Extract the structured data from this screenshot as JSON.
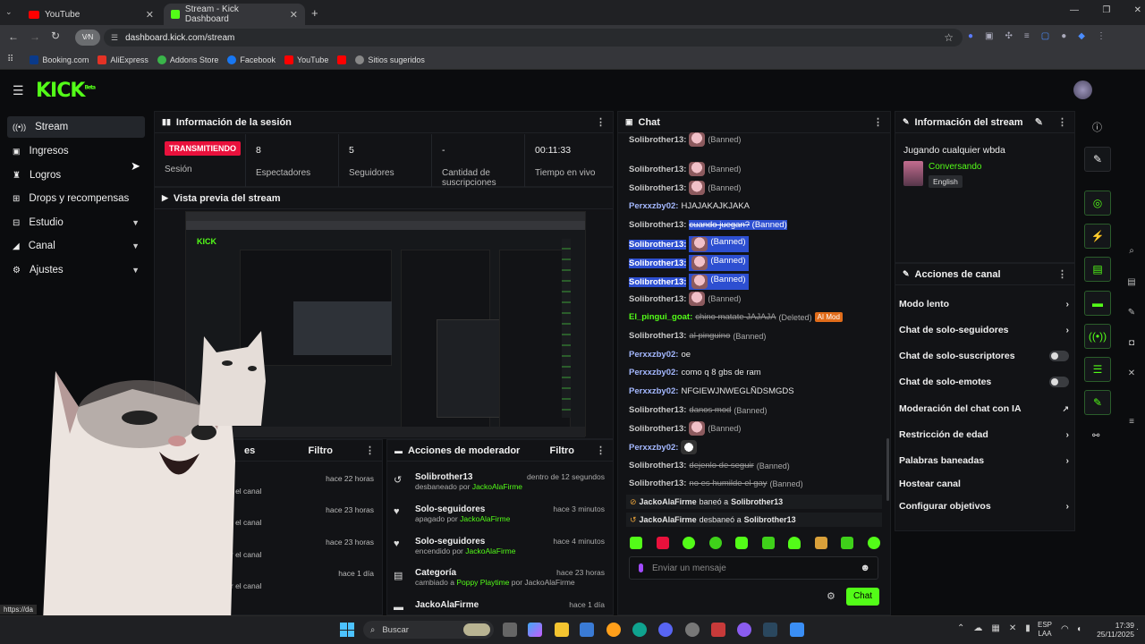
{
  "browser": {
    "tabs": [
      {
        "label": "YouTube"
      },
      {
        "label": "Stream - Kick Dashboard"
      }
    ],
    "url": "dashboard.kick.com/stream",
    "bookmarks": [
      "Booking.com",
      "AliExpress",
      "Addons Store",
      "Facebook",
      "YouTube",
      "Sitios sugeridos"
    ]
  },
  "logo": "KICK",
  "logo_sup": "Beta",
  "sidebar": {
    "items": [
      {
        "label": "Stream"
      },
      {
        "label": "Ingresos"
      },
      {
        "label": "Logros"
      },
      {
        "label": "Drops y recompensas"
      },
      {
        "label": "Estudio"
      },
      {
        "label": "Canal"
      },
      {
        "label": "Ajustes"
      }
    ]
  },
  "session": {
    "title": "Información de la sesión",
    "live_badge": "TRANSMITIENDO",
    "live_label": "Sesión",
    "stats": [
      {
        "value": "8",
        "label": "Espectadores"
      },
      {
        "value": "5",
        "label": "Seguidores"
      },
      {
        "value": "-",
        "label": "Cantidad de suscripciones"
      },
      {
        "value": "00:11:33",
        "label": "Tiempo en vivo"
      }
    ]
  },
  "preview": {
    "title": "Vista previa del stream"
  },
  "events": {
    "title_suffix": "es",
    "filter": "Filtro",
    "rows": [
      {
        "time": "hace 22 horas",
        "text": "ir el canal"
      },
      {
        "time": "hace 23 horas",
        "text": "ir el canal"
      },
      {
        "time": "hace 23 horas",
        "text": "ir el canal"
      },
      {
        "time": "hace 1 día",
        "text": "ir el canal"
      }
    ]
  },
  "modactions": {
    "title": "Acciones de moderador",
    "filter": "Filtro",
    "rows": [
      {
        "title": "Solibrother13",
        "pre": "desbaneado por",
        "by": "JackoAlaFirme",
        "post": "",
        "time": "dentro de 12 segundos"
      },
      {
        "title": "Solo-seguidores",
        "pre": "apagado por",
        "by": "JackoAlaFirme",
        "post": "",
        "time": "hace 3 minutos"
      },
      {
        "title": "Solo-seguidores",
        "pre": "encendido por",
        "by": "JackoAlaFirme",
        "post": "",
        "time": "hace 4 minutos"
      },
      {
        "title": "Categoría",
        "pre": "cambiado a",
        "by": "Poppy Playtime",
        "post": "por JackoAlaFirme",
        "time": "hace 23 horas"
      },
      {
        "title": "JackoAlaFirme",
        "pre": "",
        "by": "",
        "post": "",
        "time": "hace 1 día"
      }
    ]
  },
  "chat": {
    "title": "Chat",
    "lines": [
      {
        "user": "Solibrother13:",
        "msg": "",
        "ban": "(Banned)",
        "emote": true
      },
      {
        "user": "Solibrother13:",
        "msg": "",
        "ban": "(Banned)",
        "emote": true
      },
      {
        "user": "Solibrother13:",
        "msg": "",
        "ban": "(Banned)",
        "emote": true
      },
      {
        "user": "Perxxzby02:",
        "msg": "HJAJAKAJKJAKA",
        "ban": ""
      },
      {
        "user": "Solibrother13:",
        "msg": "cuando juegan?",
        "ban": "(Banned)"
      },
      {
        "user": "Solibrother13:",
        "msg": "",
        "ban": "(Banned)",
        "emote": true
      },
      {
        "user": "Solibrother13:",
        "msg": "",
        "ban": "(Banned)",
        "emote": true
      },
      {
        "user": "Solibrother13:",
        "msg": "",
        "ban": "(Banned)",
        "emote": true
      },
      {
        "user": "Solibrother13:",
        "msg": "",
        "ban": "(Banned)",
        "emote": true
      },
      {
        "user": "El_pingui_goat:",
        "msg": "chino matate JAJAJA",
        "ban": "(Deleted)",
        "tag": "AI Mod"
      },
      {
        "user": "Solibrother13:",
        "msg": "al pinguino",
        "ban": "(Banned)"
      },
      {
        "user": "Perxxzby02:",
        "msg": "oe",
        "ban": ""
      },
      {
        "user": "Perxxzby02:",
        "msg": "como q 8 gbs de ram",
        "ban": ""
      },
      {
        "user": "Perxxzby02:",
        "msg": "NFGIEWJNWEGLÑDSMGDS",
        "ban": ""
      },
      {
        "user": "Solibrother13:",
        "msg": "danos mod",
        "ban": "(Banned)"
      },
      {
        "user": "Solibrother13:",
        "msg": "",
        "ban": "(Banned)",
        "emote": true
      },
      {
        "user": "Perxxzby02:",
        "msg": "",
        "ban": "",
        "emote": true
      },
      {
        "user": "Solibrother13:",
        "msg": "dejenlo de seguir",
        "ban": "(Banned)"
      },
      {
        "user": "Solibrother13:",
        "msg": "no es humilde el gay",
        "ban": "(Banned)"
      }
    ],
    "system": [
      {
        "actor": "JackoAlaFirme",
        "verb": "baneó a",
        "target": "Solibrother13"
      },
      {
        "actor": "JackoAlaFirme",
        "verb": "desbaneó a",
        "target": "Solibrother13"
      }
    ],
    "input_placeholder": "Enviar un mensaje",
    "send_label": "Chat"
  },
  "stream_info": {
    "title": "Información del stream",
    "stream_title": "Jugando cualquier wbda",
    "category": "Conversando",
    "language": "English"
  },
  "channel_actions": {
    "title": "Acciones de canal",
    "items": [
      {
        "label": "Modo lento",
        "kind": "arrow"
      },
      {
        "label": "Chat de solo-seguidores",
        "kind": "arrow"
      },
      {
        "label": "Chat de solo-suscriptores",
        "kind": "toggle"
      },
      {
        "label": "Chat de solo-emotes",
        "kind": "toggle"
      },
      {
        "label": "Moderación del chat con IA",
        "kind": "external"
      },
      {
        "label": "Restricción de edad",
        "kind": "arrow"
      },
      {
        "label": "Palabras baneadas",
        "kind": "arrow"
      },
      {
        "label": "Hostear canal",
        "kind": "none"
      },
      {
        "label": "Configurar objetivos",
        "kind": "arrow"
      }
    ]
  },
  "taskbar": {
    "search": "Buscar",
    "lang": "ESP",
    "lang2": "LAA",
    "time": "17:39",
    "date": "25/11/2025"
  },
  "status_url": "https://da"
}
